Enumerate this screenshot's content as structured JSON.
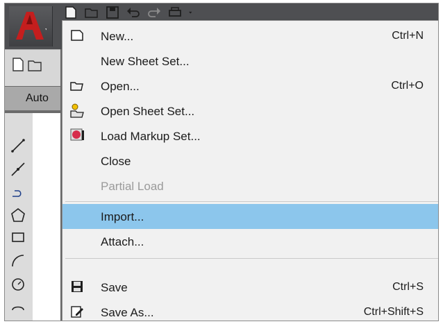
{
  "toolbar": {
    "partial_doc_tab_label": "Auto"
  },
  "menu": {
    "items": [
      {
        "label": "New...",
        "shortcut": "Ctrl+N"
      },
      {
        "label": "New Sheet Set...",
        "shortcut": ""
      },
      {
        "label": "Open...",
        "shortcut": "Ctrl+O"
      },
      {
        "label": "Open Sheet Set...",
        "shortcut": ""
      },
      {
        "label": "Load Markup Set...",
        "shortcut": ""
      },
      {
        "label": "Close",
        "shortcut": ""
      },
      {
        "label": "Partial Load",
        "shortcut": "",
        "disabled": true
      },
      {
        "label": "Import...",
        "shortcut": "",
        "highlighted": true
      },
      {
        "label": "Attach...",
        "shortcut": ""
      },
      {
        "label": "Save",
        "shortcut": "Ctrl+S"
      },
      {
        "label": "Save As...",
        "shortcut": "Ctrl+Shift+S"
      }
    ]
  },
  "colors": {
    "highlight": "#8cc6ec",
    "menu_bg": "#f1f1f1",
    "app_red": "#c41e1e",
    "disabled_text": "#9a9a9a"
  },
  "icons": {
    "app": "autocad-a-icon",
    "new": "new-document-icon",
    "open": "open-folder-icon",
    "open_sheet_set": "sheet-set-open-icon",
    "markup": "markup-set-icon",
    "save": "floppy-disk-icon",
    "save_as": "save-as-pencil-icon"
  }
}
